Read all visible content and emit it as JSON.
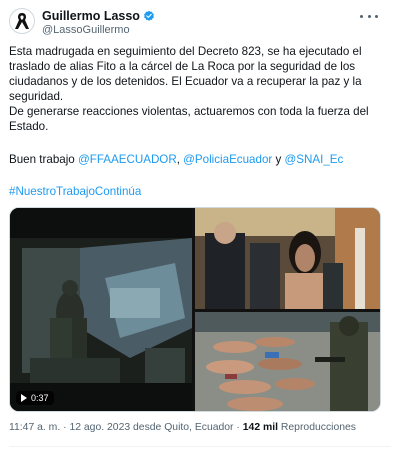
{
  "author": {
    "display_name": "Guillermo Lasso",
    "handle": "@LassoGuillermo",
    "verified": true,
    "avatar_icon": "mourning-ribbon-icon"
  },
  "tweet": {
    "paragraph1": "Esta madrugada en seguimiento del Decreto 823, se ha ejecutado el traslado de alias Fito a la cárcel de La Roca por la seguridad de los ciudadanos y de los detenidos. El Ecuador va a recuperar la paz y la seguridad.",
    "paragraph2": "De generarse reacciones violentas, actuaremos con toda la fuerza del Estado.",
    "thanks_prefix": "Buen trabajo ",
    "mention1": "@FFAAECUADOR",
    "sep1": ", ",
    "mention2": "@PoliciaEcuador",
    "sep2": " y ",
    "mention3": "@SNAI_Ec",
    "hashtag": "#NuestroTrabajoContinúa"
  },
  "media": {
    "video_duration": "0:37"
  },
  "footer": {
    "time": "11:47 a. m.",
    "dot1": " · ",
    "date": "12 ago. 2023 desde Quito, Ecuador",
    "dot2": " · ",
    "views_count": "142 mil",
    "views_label": " Reproducciones"
  },
  "colors": {
    "link": "#1d9bf0",
    "muted": "#536471",
    "verified": "#1d9bf0"
  }
}
